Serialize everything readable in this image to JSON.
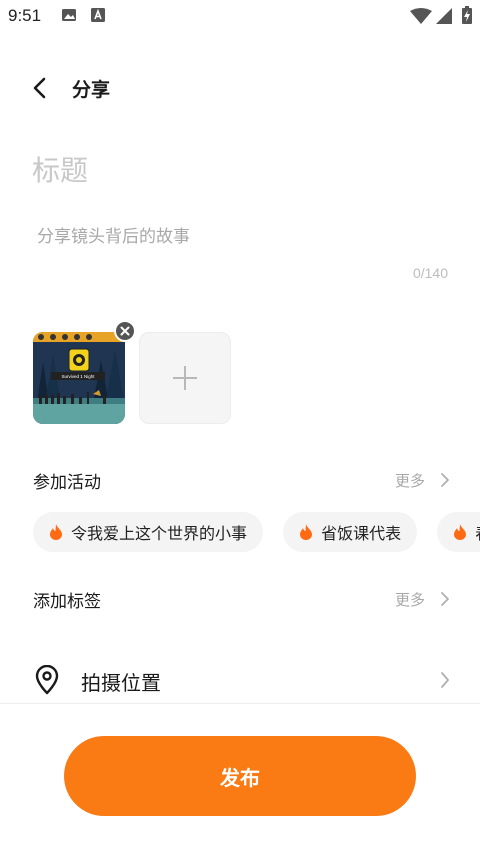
{
  "status_bar": {
    "time": "9:51",
    "icons": [
      "image-icon",
      "font-a-icon",
      "wifi-icon",
      "cell-signal-icon",
      "battery-charging-icon"
    ]
  },
  "header": {
    "back_icon": "chevron-left-icon",
    "title": "分享"
  },
  "composer": {
    "title_placeholder": "标题",
    "story_placeholder": "分享镜头背后的故事",
    "char_counter": "0/140"
  },
  "media": {
    "thumbnail_caption": "Survived 1 Night",
    "remove_icon": "close-icon",
    "add_icon": "plus-icon"
  },
  "activities": {
    "label": "参加活动",
    "more_label": "更多",
    "chips": [
      {
        "label": "令我爱上这个世界的小事"
      },
      {
        "label": "省饭课代表"
      },
      {
        "label": "春"
      }
    ]
  },
  "tags": {
    "label": "添加标签",
    "more_label": "更多"
  },
  "location": {
    "icon": "location-pin-icon",
    "label": "拍摄位置"
  },
  "footer": {
    "publish_label": "发布"
  },
  "colors": {
    "accent": "#fa7a14",
    "flame": "#ff6a13",
    "muted_text": "#a8a8a8"
  }
}
